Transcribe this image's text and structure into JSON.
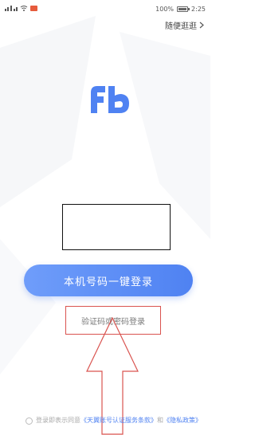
{
  "status_bar": {
    "carrier_icons": "signal-icons",
    "battery_percent": "100%",
    "battery_level": 1.0,
    "time": "2:25"
  },
  "header": {
    "skip_label": "随便逛逛",
    "skip_icon": "chevron-right-icon"
  },
  "logo": {
    "text": "Fb",
    "color": "#4f82f2"
  },
  "login": {
    "one_click_label": "本机号码一键登录",
    "alt_login_label": "验证码或密码登录"
  },
  "agreement": {
    "prefix": "登录即表示同意",
    "link1": "《天翼账号认证服务条款》",
    "middle": "和",
    "link2": "《隐私政策》"
  },
  "colors": {
    "accent": "#4f82f2",
    "annotation": "#d9534f"
  }
}
